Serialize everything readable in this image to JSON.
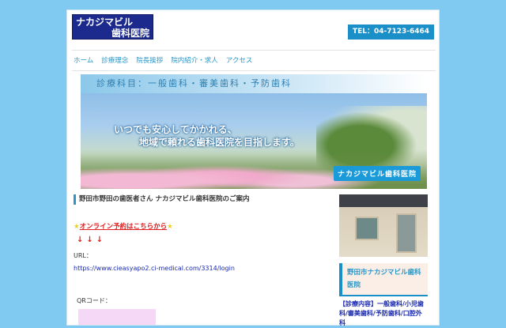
{
  "header": {
    "logo_line1": "ナカジマビル",
    "logo_line2": "歯科医院",
    "tel": "TEL：04-7123-6464"
  },
  "nav": [
    "ホーム",
    "診療理念",
    "院長挨拶",
    "院内紹介・求人",
    "アクセス"
  ],
  "banner": {
    "heading": "診療科目：一般歯科・審美歯科・予防歯科",
    "line1": "いつでも安心してかかれる、",
    "line2": "地域で頼れる歯科医院を目指します。",
    "badge": "ナカジマビル歯科医院"
  },
  "main": {
    "title": "野田市野田の歯医者さん ナカジマビル歯科医院のご案内",
    "star": "★",
    "online_link": "オンライン予約はこちらから",
    "arrows": "↓↓↓",
    "url_label": "URL：",
    "url": "https://www.cieasyapo2.ci-medical.com/3314/login",
    "qr_label": "QRコード："
  },
  "sidebar": {
    "box_title": "野田市ナカジマビル歯科医院",
    "services": "【診療内容】一般歯科/小児歯科/審美歯科/予防歯科/口腔外科"
  }
}
